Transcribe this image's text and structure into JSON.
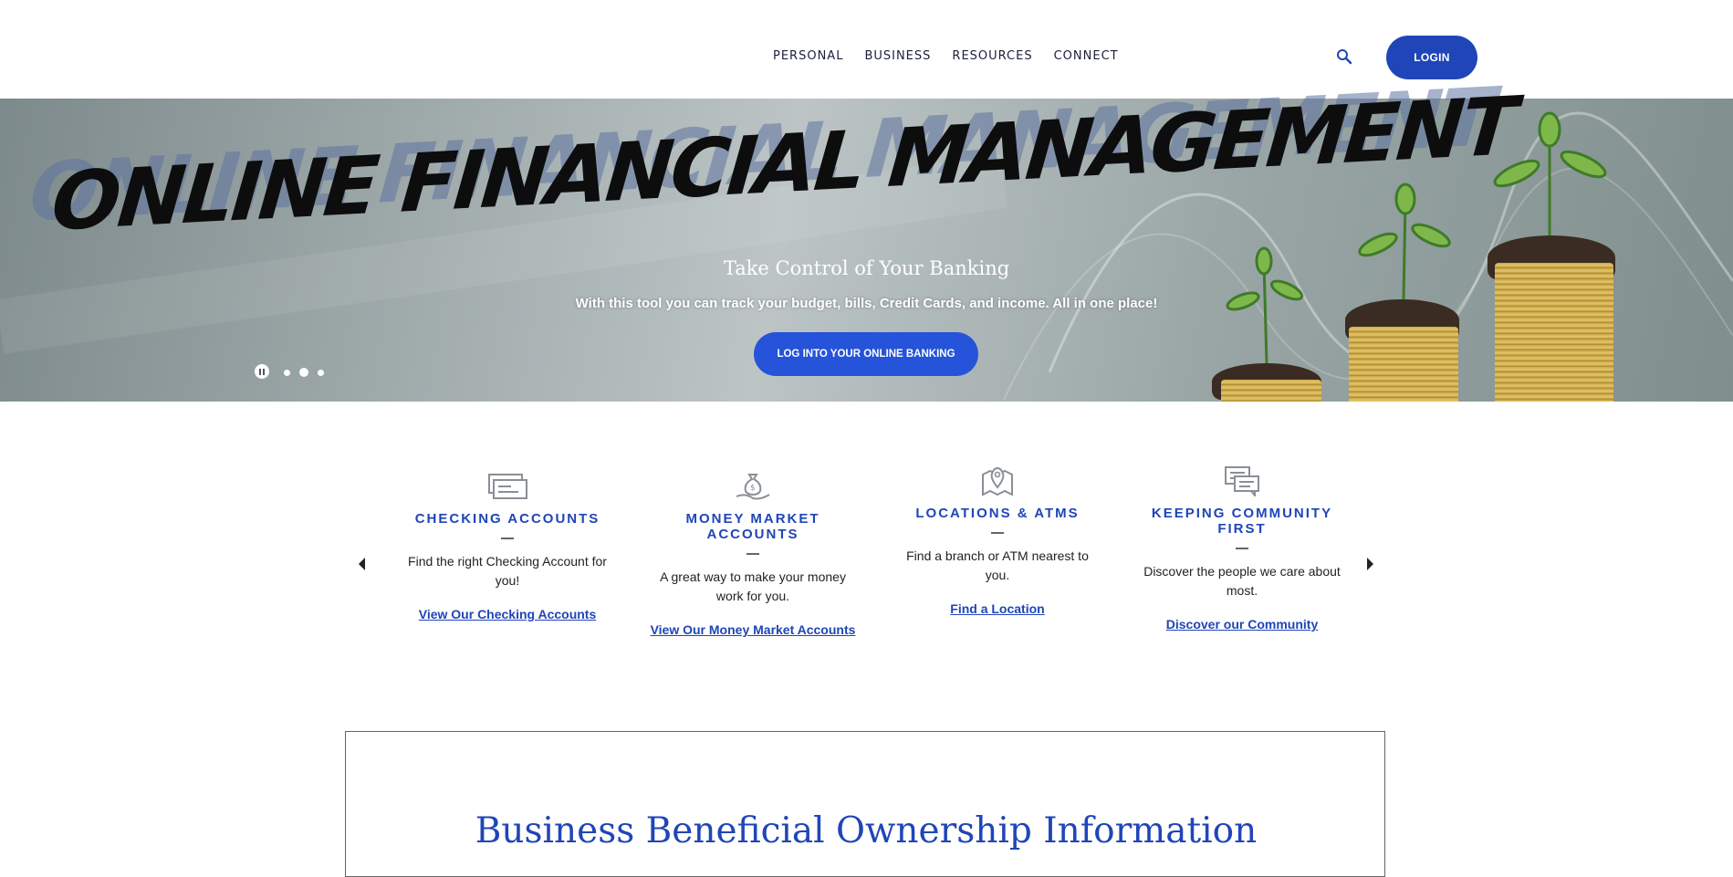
{
  "header": {
    "nav": [
      "PERSONAL",
      "BUSINESS",
      "RESOURCES",
      "CONNECT"
    ],
    "search_icon": "search-icon",
    "login_label": "LOGIN"
  },
  "hero": {
    "title": "ONLINE FINANCIAL MANAGEMENT",
    "heading": "Take Control of Your Banking",
    "subheading": "With this tool you can track your budget, bills, Credit Cards, and income. All in one place!",
    "cta_label": "LOG INTO YOUR ONLINE BANKING",
    "slides_count": 3,
    "active_slide": 2
  },
  "features": [
    {
      "icon": "checks-icon",
      "title": "CHECKING ACCOUNTS",
      "text": "Find the right Checking Account for you!",
      "link": "View Our Checking Accounts"
    },
    {
      "icon": "money-bag-hand-icon",
      "title": "MONEY MARKET ACCOUNTS",
      "text": "A great way to make your money work for you.",
      "link": "View Our Money Market Accounts"
    },
    {
      "icon": "map-pin-icon",
      "title": "LOCATIONS & ATMS",
      "text": "Find a branch or ATM nearest to you.",
      "link": "Find a Location"
    },
    {
      "icon": "chat-bubbles-icon",
      "title": "KEEPING COMMUNITY FIRST",
      "text": "Discover the people we care about most.",
      "link": "Discover our Community"
    }
  ],
  "info_box": {
    "title": "Business Beneficial Ownership Information"
  },
  "colors": {
    "brand_blue": "#1f45b8",
    "cta_blue": "#2553d9"
  }
}
